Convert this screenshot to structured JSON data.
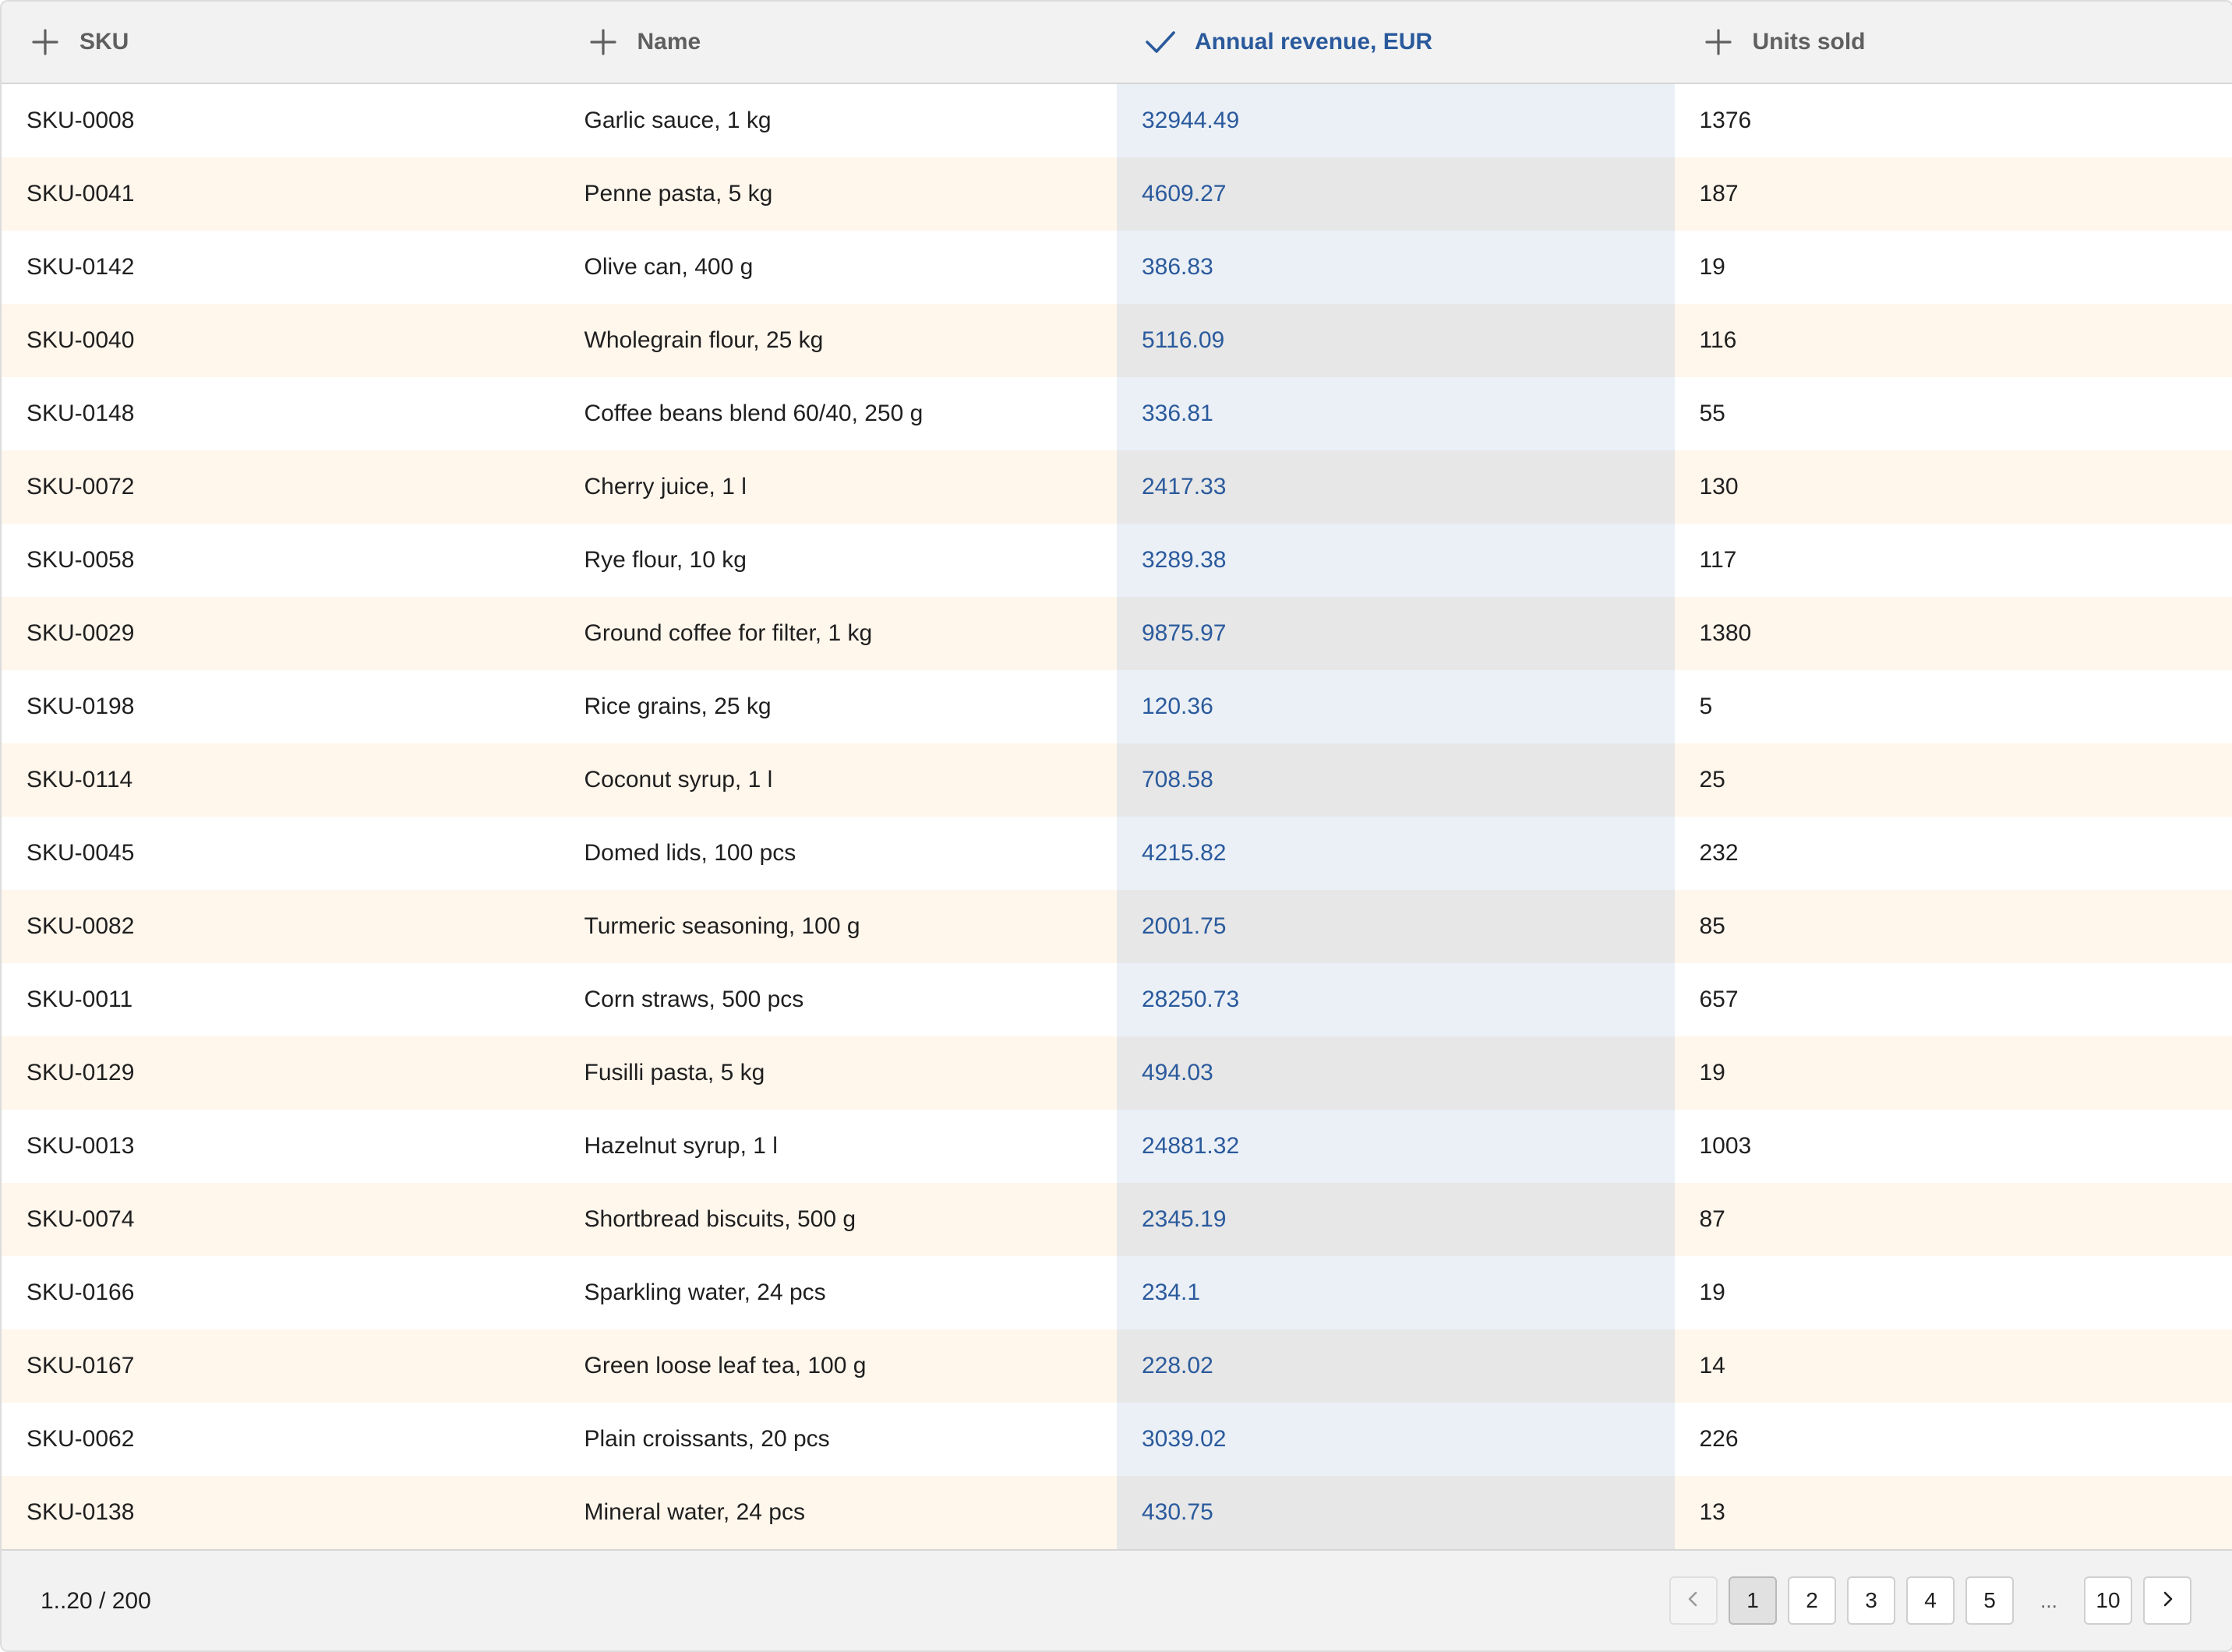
{
  "columns": [
    {
      "label": "SKU",
      "icon": "plus-icon",
      "active": false
    },
    {
      "label": "Name",
      "icon": "plus-icon",
      "active": false
    },
    {
      "label": "Annual revenue, EUR",
      "icon": "checkmark-icon",
      "active": true
    },
    {
      "label": "Units sold",
      "icon": "plus-icon",
      "active": false
    }
  ],
  "rows": [
    {
      "sku": "SKU-0008",
      "name": "Garlic sauce, 1 kg",
      "revenue": "32944.49",
      "units": "1376"
    },
    {
      "sku": "SKU-0041",
      "name": "Penne pasta, 5 kg",
      "revenue": "4609.27",
      "units": "187"
    },
    {
      "sku": "SKU-0142",
      "name": "Olive can, 400 g",
      "revenue": "386.83",
      "units": "19"
    },
    {
      "sku": "SKU-0040",
      "name": "Wholegrain flour, 25 kg",
      "revenue": "5116.09",
      "units": "116"
    },
    {
      "sku": "SKU-0148",
      "name": "Coffee beans blend 60/40, 250 g",
      "revenue": "336.81",
      "units": "55"
    },
    {
      "sku": "SKU-0072",
      "name": "Cherry juice, 1 l",
      "revenue": "2417.33",
      "units": "130"
    },
    {
      "sku": "SKU-0058",
      "name": "Rye flour, 10 kg",
      "revenue": "3289.38",
      "units": "117"
    },
    {
      "sku": "SKU-0029",
      "name": "Ground coffee for filter, 1 kg",
      "revenue": "9875.97",
      "units": "1380"
    },
    {
      "sku": "SKU-0198",
      "name": "Rice grains, 25 kg",
      "revenue": "120.36",
      "units": "5"
    },
    {
      "sku": "SKU-0114",
      "name": "Coconut syrup, 1 l",
      "revenue": "708.58",
      "units": "25"
    },
    {
      "sku": "SKU-0045",
      "name": "Domed lids, 100 pcs",
      "revenue": "4215.82",
      "units": "232"
    },
    {
      "sku": "SKU-0082",
      "name": "Turmeric seasoning, 100 g",
      "revenue": "2001.75",
      "units": "85"
    },
    {
      "sku": "SKU-0011",
      "name": "Corn straws, 500 pcs",
      "revenue": "28250.73",
      "units": "657"
    },
    {
      "sku": "SKU-0129",
      "name": "Fusilli pasta, 5 kg",
      "revenue": "494.03",
      "units": "19"
    },
    {
      "sku": "SKU-0013",
      "name": "Hazelnut syrup, 1 l",
      "revenue": "24881.32",
      "units": "1003"
    },
    {
      "sku": "SKU-0074",
      "name": "Shortbread biscuits, 500 g",
      "revenue": "2345.19",
      "units": "87"
    },
    {
      "sku": "SKU-0166",
      "name": "Sparkling water, 24 pcs",
      "revenue": "234.1",
      "units": "19"
    },
    {
      "sku": "SKU-0167",
      "name": "Green loose leaf tea, 100 g",
      "revenue": "228.02",
      "units": "14"
    },
    {
      "sku": "SKU-0062",
      "name": "Plain croissants, 20 pcs",
      "revenue": "3039.02",
      "units": "226"
    },
    {
      "sku": "SKU-0138",
      "name": "Mineral water, 24 pcs",
      "revenue": "430.75",
      "units": "13"
    }
  ],
  "footer": {
    "range": "1..20 / 200",
    "pages": [
      "1",
      "2",
      "3",
      "4",
      "5"
    ],
    "current_page": "1",
    "ellipsis": "...",
    "last_page": "10",
    "prev_icon": "chevron-left-icon",
    "next_icon": "chevron-right-icon"
  },
  "colors": {
    "accent": "#2a5a9c",
    "header_bg": "#f2f2f2",
    "row_alt_bg": "#fff6ec",
    "sorted_col_bg": "#ebf0f7"
  }
}
